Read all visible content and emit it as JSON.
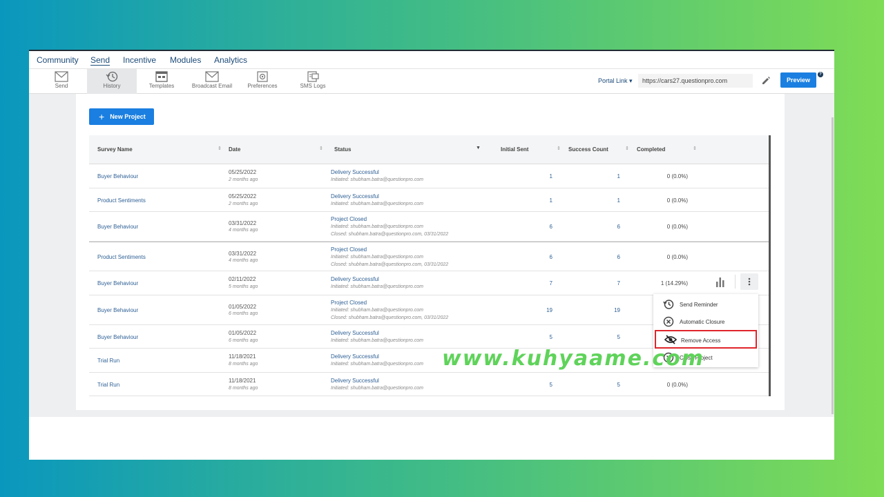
{
  "topnav": {
    "items": [
      {
        "label": "Community"
      },
      {
        "label": "Send",
        "active": true
      },
      {
        "label": "Incentive"
      },
      {
        "label": "Modules"
      },
      {
        "label": "Analytics"
      }
    ]
  },
  "toolbar": {
    "tools": [
      {
        "label": "Send",
        "icon": "envelope-icon"
      },
      {
        "label": "History",
        "icon": "history-icon",
        "active": true
      },
      {
        "label": "Templates",
        "icon": "templates-icon"
      },
      {
        "label": "Broadcast Email",
        "icon": "broadcast-email-icon"
      },
      {
        "label": "Preferences",
        "icon": "preferences-icon"
      },
      {
        "label": "SMS Logs",
        "icon": "sms-logs-icon"
      }
    ],
    "portal_label": "Portal Link",
    "portal_value": "https://cars27.questionpro.com",
    "preview_label": "Preview",
    "help": "?"
  },
  "new_project_label": "New Project",
  "table": {
    "headers": {
      "survey_name": "Survey Name",
      "date": "Date",
      "status": "Status",
      "initial_sent": "Initial Sent",
      "success_count": "Success Count",
      "completed": "Completed"
    },
    "rows": [
      {
        "survey": "Buyer Behaviour",
        "date": "05/25/2022",
        "ago": "2 months ago",
        "status": "Delivery Successful",
        "initiated": "Initiated: shubham.batra@questionpro.com",
        "closed": "",
        "sent": "1",
        "success": "1",
        "completed": "0 (0.0%)"
      },
      {
        "survey": "Product Sentiments",
        "date": "05/25/2022",
        "ago": "2 months ago",
        "status": "Delivery Successful",
        "initiated": "Initiated: shubham.batra@questionpro.com",
        "closed": "",
        "sent": "1",
        "success": "1",
        "completed": "0 (0.0%)"
      },
      {
        "survey": "Buyer Behaviour",
        "date": "03/31/2022",
        "ago": "4 months ago",
        "status": "Project Closed",
        "initiated": "Initiated: shubham.batra@questionpro.com",
        "closed": "Closed: shubham.batra@questionpro.com, 03/31/2022",
        "sent": "6",
        "success": "6",
        "completed": "0 (0.0%)"
      },
      {
        "survey": "Product Sentiments",
        "date": "03/31/2022",
        "ago": "4 months ago",
        "status": "Project Closed",
        "initiated": "Initiated: shubham.batra@questionpro.com",
        "closed": "Closed: shubham.batra@questionpro.com, 03/31/2022",
        "sent": "6",
        "success": "6",
        "completed": "0 (0.0%)"
      },
      {
        "survey": "Buyer Behaviour",
        "date": "02/11/2022",
        "ago": "5 months ago",
        "status": "Delivery Successful",
        "initiated": "Initiated: shubham.batra@questionpro.com",
        "closed": "",
        "sent": "7",
        "success": "7",
        "completed": "1 (14.29%)"
      },
      {
        "survey": "Buyer Behaviour",
        "date": "01/05/2022",
        "ago": "6 months ago",
        "status": "Project Closed",
        "initiated": "Initiated: shubham.batra@questionpro.com",
        "closed": "Closed: shubham.batra@questionpro.com, 03/31/2022",
        "sent": "19",
        "success": "19",
        "completed": ""
      },
      {
        "survey": "Buyer Behaviour",
        "date": "01/05/2022",
        "ago": "6 months ago",
        "status": "Delivery Successful",
        "initiated": "Initiated: shubham.batra@questionpro.com",
        "closed": "",
        "sent": "5",
        "success": "5",
        "completed": ""
      },
      {
        "survey": "Trial Run",
        "date": "11/18/2021",
        "ago": "8 months ago",
        "status": "Delivery Successful",
        "initiated": "Initiated: shubham.batra@questionpro.com",
        "closed": "",
        "sent": "",
        "success": "",
        "completed": ""
      },
      {
        "survey": "Trial Run",
        "date": "11/18/2021",
        "ago": "8 months ago",
        "status": "Delivery Successful",
        "initiated": "Initiated: shubham.batra@questionpro.com",
        "closed": "",
        "sent": "5",
        "success": "5",
        "completed": "0 (0.0%)"
      }
    ]
  },
  "context_menu": {
    "items": [
      {
        "label": "Send Reminder",
        "icon": "reminder-icon"
      },
      {
        "label": "Automatic Closure",
        "icon": "close-circle-icon"
      },
      {
        "label": "Remove Access",
        "icon": "eye-slash-icon",
        "highlighted": true
      },
      {
        "label": "Close Project",
        "icon": "close-circle-icon"
      }
    ]
  },
  "watermark": "www.kuhyaame.com",
  "colors": {
    "accent": "#1a7fe0",
    "link": "#2d5f94",
    "highlight_border": "#e0242a",
    "watermark": "#5fd35a"
  }
}
